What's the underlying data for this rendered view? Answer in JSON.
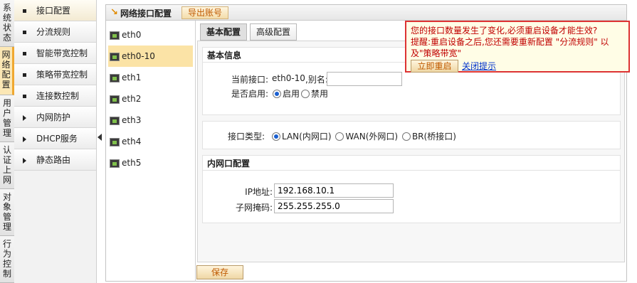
{
  "vtabs": [
    {
      "label": "系统状态",
      "chars": [
        "系",
        "统",
        "状",
        "态"
      ]
    },
    {
      "label": "网络配置",
      "chars": [
        "网",
        "络",
        "配",
        "置"
      ]
    },
    {
      "label": "用户管理",
      "chars": [
        "用",
        "户",
        "管",
        "理"
      ]
    },
    {
      "label": "认证上网",
      "chars": [
        "认",
        "证",
        "上",
        "网"
      ]
    },
    {
      "label": "对象管理",
      "chars": [
        "对",
        "象",
        "管",
        "理"
      ]
    },
    {
      "label": "行为控制",
      "chars": [
        "行",
        "为",
        "控",
        "制"
      ]
    }
  ],
  "submenu": [
    {
      "label": "接口配置",
      "marker": "square"
    },
    {
      "label": "分流规则",
      "marker": "square"
    },
    {
      "label": "智能带宽控制",
      "marker": "square"
    },
    {
      "label": "策略带宽控制",
      "marker": "square"
    },
    {
      "label": "连接数控制",
      "marker": "square"
    },
    {
      "label": "内网防护",
      "marker": "triangle"
    },
    {
      "label": "DHCP服务",
      "marker": "triangle"
    },
    {
      "label": "静态路由",
      "marker": "triangle"
    }
  ],
  "header": {
    "title": "网络接口配置",
    "export_label": "导出账号"
  },
  "interfaces": [
    "eth0",
    "eth0-10",
    "eth1",
    "eth2",
    "eth3",
    "eth4",
    "eth5"
  ],
  "tabs": [
    "基本配置",
    "高级配置"
  ],
  "basic_info": {
    "section_title": "基本信息",
    "current_if_label": "当前接口:",
    "current_if_value": "eth0-10",
    "alias_label": ",别名:",
    "alias_value": "",
    "enable_label": "是否启用:",
    "enable_option": "启用",
    "disable_option": "禁用"
  },
  "if_type": {
    "label": "接口类型:",
    "lan": "LAN(内网口)",
    "wan": "WAN(外网口)",
    "br": "BR(桥接口)"
  },
  "lan_config": {
    "section_title": "内网口配置",
    "ip_label": "IP地址:",
    "ip_value": "192.168.10.1",
    "mask_label": "子网掩码:",
    "mask_value": "255.255.255.0"
  },
  "save_label": "保存",
  "alert": {
    "line1": "您的接口数量发生了变化,必须重启设备才能生效?",
    "line2": "提醒:重启设备之后,您还需要重新配置 \"分流规则\" 以",
    "line3": "及\"策略带宽\"",
    "reboot_label": "立即重启",
    "close_label": "关闭提示"
  },
  "colors": {
    "accent": "#f0a830",
    "alert_border": "#dd3333",
    "alert_text": "#c00000",
    "link": "#0033cc"
  }
}
